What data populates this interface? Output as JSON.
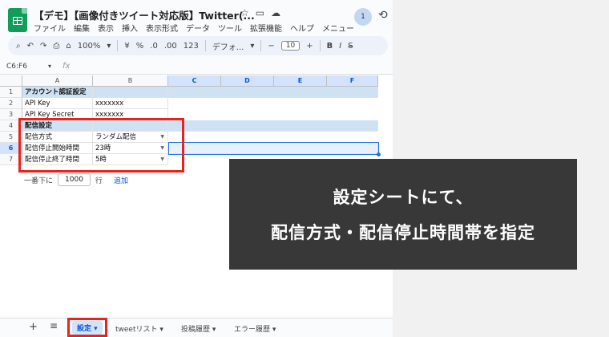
{
  "doc": {
    "title": "【デモ】【画像付きツイート対応版】Twitter(..."
  },
  "menu": [
    "ファイル",
    "編集",
    "表示",
    "挿入",
    "表示形式",
    "データ",
    "ツール",
    "拡張機能",
    "ヘルプ",
    "メニュー"
  ],
  "account": {
    "initial": "1"
  },
  "toolbar": {
    "zoom": "100%",
    "currency": "¥",
    "percent": "%",
    "decimal_dec": ".0",
    "decimal_inc": ".00",
    "number_format": "123",
    "font": "デフォ...",
    "font_size": "10",
    "bold": "B",
    "italic": "I",
    "strike": "S",
    "minus": "−",
    "plus": "+"
  },
  "formula_bar": {
    "cell_ref": "C6:F6",
    "fx": "fx"
  },
  "grid": {
    "columns": [
      "A",
      "B",
      "C",
      "D",
      "E",
      "F"
    ],
    "rows": [
      "1",
      "2",
      "3",
      "4",
      "5",
      "6",
      "7"
    ],
    "cells": {
      "a1": "アカウント認証設定",
      "a2": "API Key",
      "b2": "xxxxxxx",
      "a3": "API Key Secret",
      "b3": "xxxxxxx",
      "a4": "配信設定",
      "a5": "配信方式",
      "b5": "ランダム配信",
      "a6": "配信停止開始時間",
      "b6": "23時",
      "a7": "配信停止終了時間",
      "b7": "5時"
    }
  },
  "add_rows": {
    "prefix": "一番下に",
    "count": "1000",
    "unit": "行",
    "action": "追加"
  },
  "sheets": [
    {
      "label": "設定",
      "active": true
    },
    {
      "label": "tweetリスト",
      "active": false
    },
    {
      "label": "投稿履歴",
      "active": false
    },
    {
      "label": "エラー履歴",
      "active": false
    }
  ],
  "callout": {
    "line1": "設定シートにて、",
    "line2": "配信方式・配信停止時間帯を指定"
  },
  "colors": {
    "accent": "#1a73e8",
    "highlight_red": "#e8231d",
    "header_fill": "#cfe2f3",
    "callout_bg": "#383838"
  }
}
